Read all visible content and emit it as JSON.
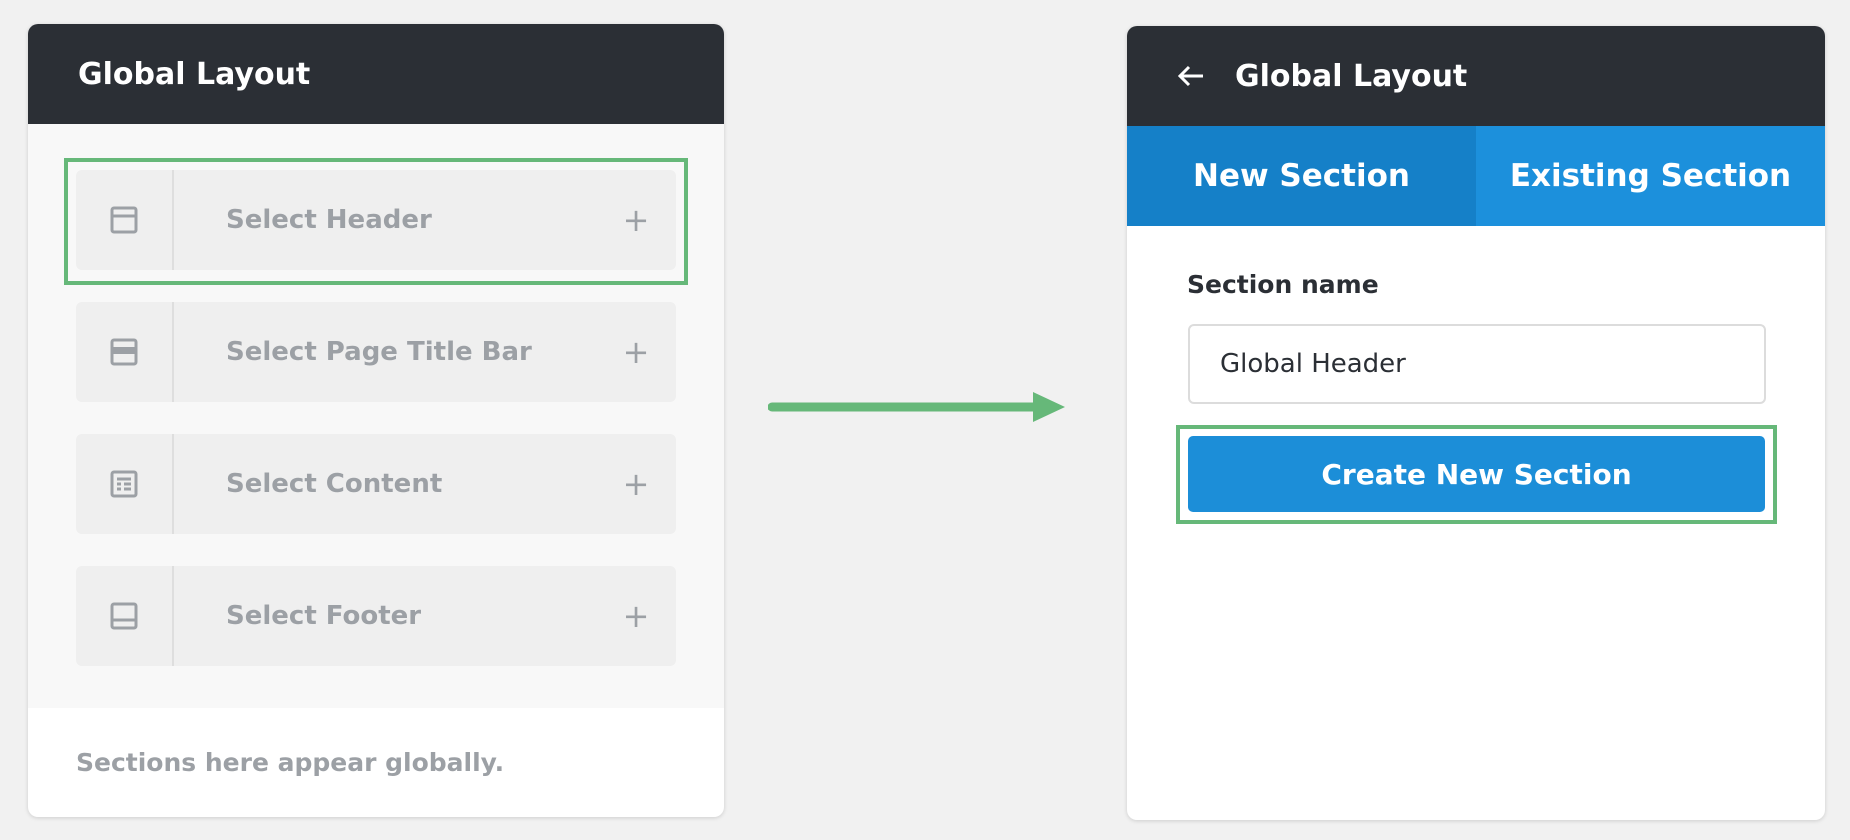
{
  "left_panel": {
    "title": "Global Layout",
    "items": [
      {
        "label": "Select Header",
        "icon": "header-layout-icon"
      },
      {
        "label": "Select Page Title Bar",
        "icon": "page-title-bar-icon"
      },
      {
        "label": "Select Content",
        "icon": "content-layout-icon"
      },
      {
        "label": "Select Footer",
        "icon": "footer-layout-icon"
      }
    ],
    "add_icon": "+",
    "footer_note": "Sections here appear globally."
  },
  "right_panel": {
    "title": "Global Layout",
    "back_icon": "back-arrow-icon",
    "tabs": [
      {
        "label": "New Section",
        "active": true
      },
      {
        "label": "Existing Section",
        "active": false
      }
    ],
    "field_label": "Section name",
    "field_value": "Global Header",
    "button_label": "Create New Section"
  },
  "colors": {
    "header_bg": "#2b2f35",
    "accent_blue": "#1c8ed8",
    "active_tab": "#1580c8",
    "highlight_green": "#66b879",
    "muted_text": "#9ca0a5"
  }
}
